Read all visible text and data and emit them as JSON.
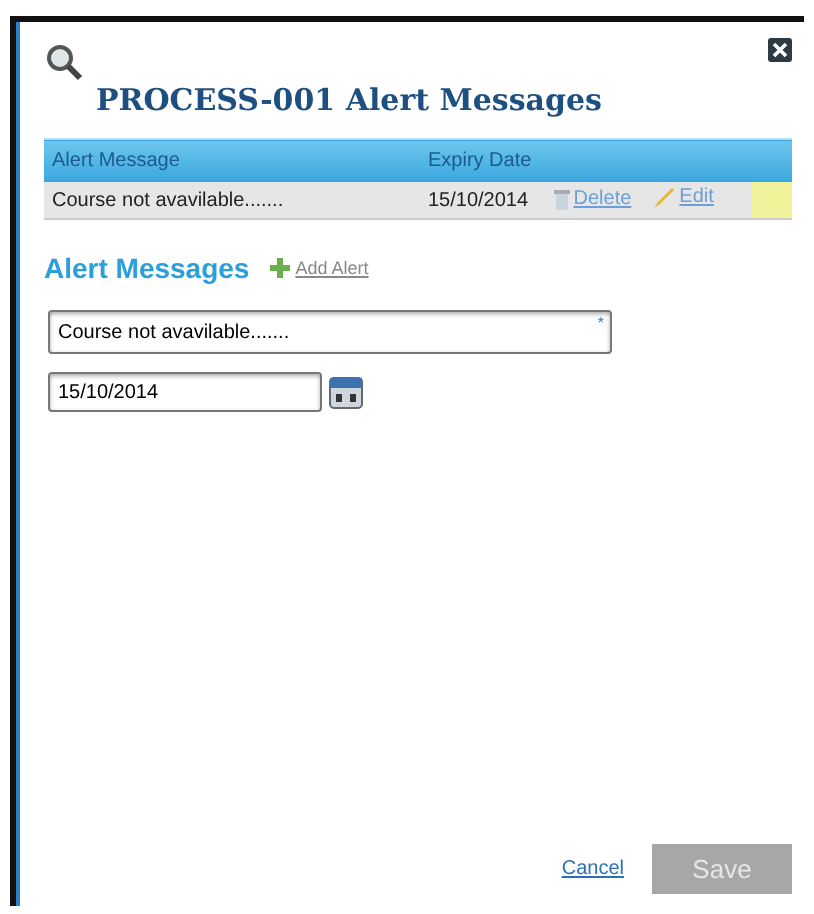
{
  "title": "PROCESS-001 Alert Messages",
  "table": {
    "columns": [
      "Alert Message",
      "Expiry Date"
    ],
    "rows": [
      {
        "message": "Course not avavilable.......",
        "expiry": "15/10/2014",
        "actions": [
          {
            "kind": "delete",
            "label": "Delete"
          },
          {
            "kind": "edit",
            "label": "Edit"
          }
        ]
      }
    ]
  },
  "section": {
    "title": "Alert Messages",
    "add_label": "Add Alert"
  },
  "form": {
    "message": "Course not avavilable.......",
    "required_mark": "*",
    "date": "15/10/2014"
  },
  "buttons": {
    "cancel": "Cancel",
    "save": {
      "label": "Save",
      "disabled": true
    }
  }
}
